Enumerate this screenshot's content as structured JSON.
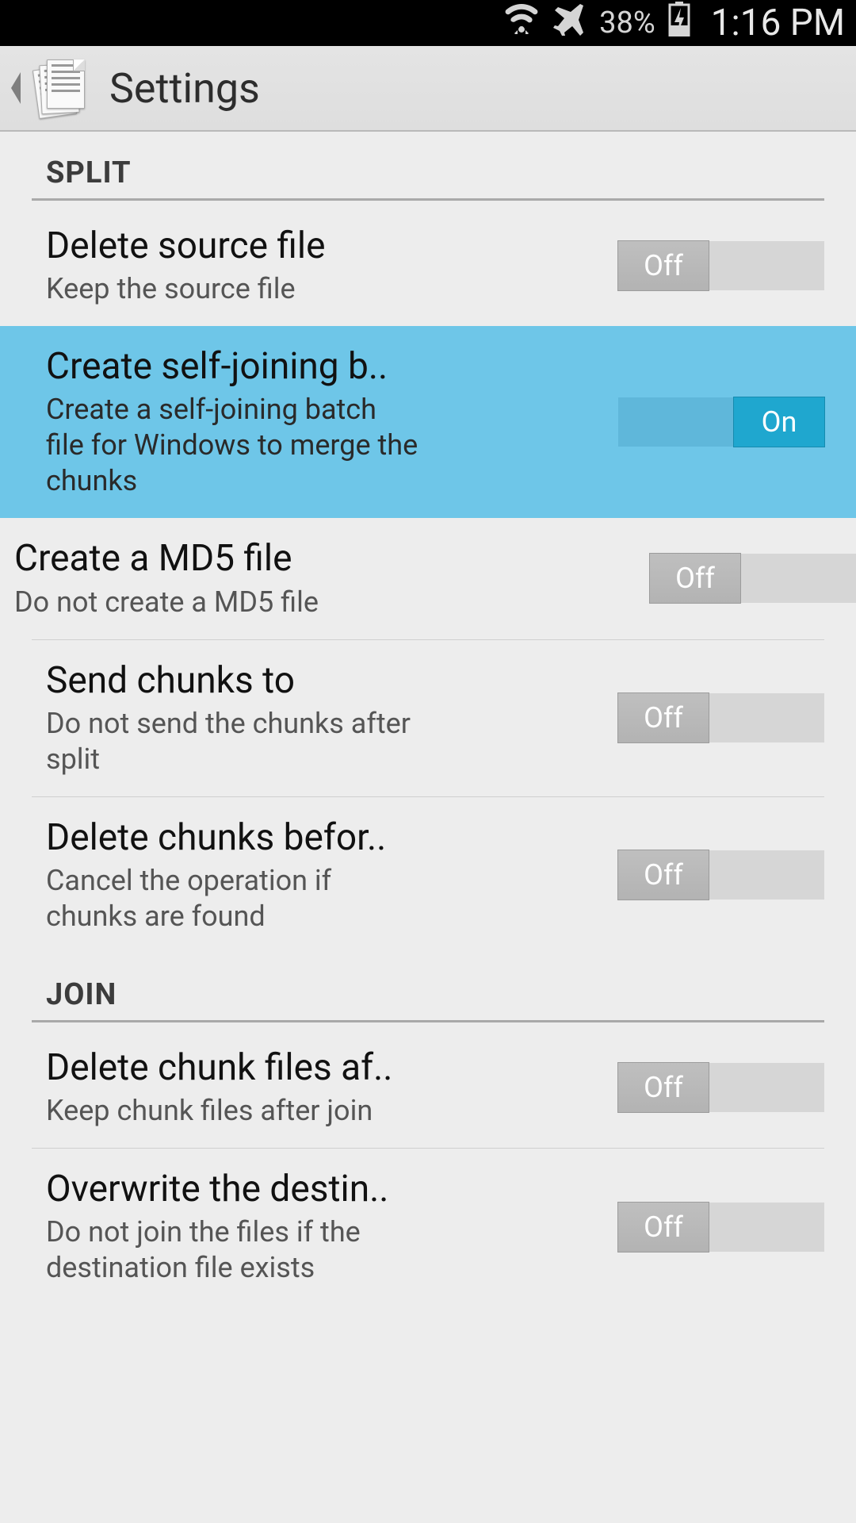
{
  "status_bar": {
    "battery_pct": "38%",
    "time": "1:16 PM"
  },
  "header": {
    "title": "Settings"
  },
  "sections": {
    "split_label": "SPLIT",
    "join_label": "JOIN"
  },
  "settings": {
    "delete_source": {
      "title": "Delete source file",
      "desc": "Keep the source file",
      "state_label": "Off"
    },
    "self_join": {
      "title": "Create self-joining b",
      "desc": "Create a self-joining batch file for Windows to merge the chunks",
      "state_label": "On"
    },
    "md5": {
      "title": "Create a MD5 file",
      "desc": "Do not create a MD5 file",
      "state_label": "Off"
    },
    "send_chunks": {
      "title": "Send chunks to",
      "desc": "Do not send the chunks after split",
      "state_label": "Off"
    },
    "delete_chunks_before": {
      "title": "Delete chunks befor",
      "desc": "Cancel the operation if chunks are found",
      "state_label": "Off"
    },
    "delete_chunk_files_after": {
      "title": "Delete chunk files af",
      "desc": "Keep chunk files after join",
      "state_label": "Off"
    },
    "overwrite_dest": {
      "title": "Overwrite the destin",
      "desc": "Do not join the files if the destination file exists",
      "state_label": "Off"
    }
  }
}
